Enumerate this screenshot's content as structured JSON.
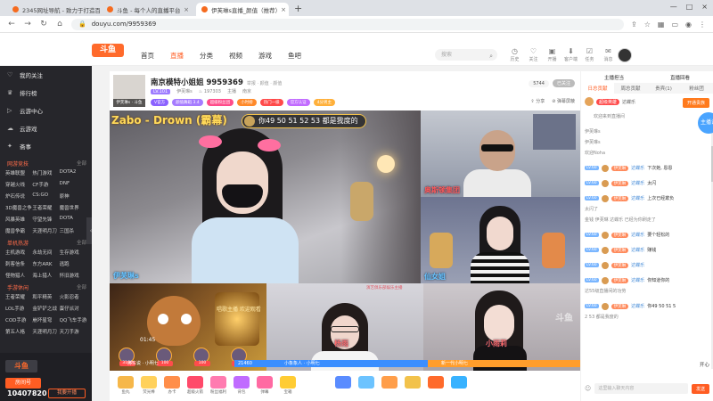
{
  "browser": {
    "tabs": [
      {
        "title": "2345网址导航 - 致力于打造百年..."
      },
      {
        "title": "斗鱼 - 每个人的直播平台"
      },
      {
        "title": "伊芙琳s直播_颜值（推荐）"
      }
    ],
    "url": "douyu.com/9959369"
  },
  "header": {
    "logo": "斗鱼",
    "nav": [
      "首页",
      "直播",
      "分类",
      "视频",
      "游戏",
      "鱼吧"
    ],
    "search_placeholder": "搜索",
    "icons": [
      {
        "name": "history",
        "label": "历史"
      },
      {
        "name": "follow",
        "label": "关注"
      },
      {
        "name": "upload",
        "label": "开播"
      },
      {
        "name": "client",
        "label": "客户端"
      },
      {
        "name": "task",
        "label": "任务"
      },
      {
        "name": "message",
        "label": "消息"
      }
    ]
  },
  "sidebar": {
    "items": [
      {
        "icon": "heart-icon",
        "label": "我的关注"
      },
      {
        "icon": "trophy-icon",
        "label": "排行榜"
      },
      {
        "icon": "play-icon",
        "label": "云游中心"
      },
      {
        "icon": "cloud-icon",
        "label": "云游戏"
      }
    ],
    "sections": [
      {
        "title": "网游竞技",
        "more": "全部",
        "items": [
          "英雄联盟",
          "热门游戏",
          "DOTA2",
          "穿越火线",
          "CF手游",
          "DNF",
          "炉石传说",
          "CS:GO",
          "原神",
          "3D魔兽之争",
          "王者荣耀",
          "魔兽世界",
          "风暴英雄",
          "守望先锋",
          "DOTA",
          "魔兽争霸",
          "天涯明月刀",
          "三国杀"
        ]
      },
      {
        "title": "单机热游",
        "more": "全部",
        "items": [
          "主机游戏",
          "永劫无间",
          "生存游戏",
          "刺客信条",
          "东方ARK",
          "逃跑",
          "怪物猎人",
          "海上猎人",
          "怀旧游戏"
        ]
      },
      {
        "title": "手游休闲",
        "more": "全部",
        "items": [
          "王者荣耀",
          "和平精英",
          "火影忍者",
          "LOL手游",
          "金铲铲之战",
          "蛋仔派对",
          "COD手游",
          "崩坏星穹",
          "QQ飞车手游",
          "第五人格",
          "天涯明月刀",
          "天刀手游"
        ]
      }
    ],
    "bottom": {
      "logo": "斗鱼",
      "room_label": "房间号",
      "room_number": "10407820",
      "live_button": "我要开播"
    },
    "decor": "斋事"
  },
  "room": {
    "anchor_tag": "伊芙琳s · 斗鱼",
    "title": "南京模特小姐姐 9959369",
    "title_sub": "举报 · 颜值 · 颜值",
    "meta": {
      "level": "LV.101",
      "name": "伊芙琳s",
      "hot": "197303",
      "tag1": "主播",
      "tag2": "南京"
    },
    "tags": [
      {
        "text": "V官方",
        "color": "#8b62ff"
      },
      {
        "text": "颜值舞蹈 3.4",
        "color": "#a67cff"
      },
      {
        "text": "超级粉丝团",
        "color": "#ff4c8a"
      },
      {
        "text": "小时榜",
        "color": "#ff8a2b"
      },
      {
        "text": "热门一级",
        "color": "#ff4a4a"
      },
      {
        "text": "官方认证",
        "color": "#c16bff"
      },
      {
        "text": "4分男主",
        "color": "#ffb03a"
      }
    ],
    "fans": "5744",
    "follow": "已关注",
    "share": "分享",
    "report": "弹幕屏蔽"
  },
  "video": {
    "song": "Zabo - Drown (霸幕)",
    "danmu": "你49 50 51 52 53 都是我度的",
    "cells": [
      {
        "name": "伊芙琳s"
      },
      {
        "name": "奥斯顿集团"
      },
      {
        "name": "仙女姐"
      },
      {
        "name": ""
      },
      {
        "name": "杨雨"
      },
      {
        "name": "小雨莉"
      }
    ],
    "cell_room": "演艺俱乐部娱乐主播",
    "bl_text": "唱歌主播 欢迎观看",
    "timer": "01:45",
    "pk": {
      "scores": [
        "3100",
        "100",
        "100",
        "1460"
      ],
      "left_value": "21460",
      "right_value": "",
      "left_fraction": 0.56,
      "names": [
        "房东说 · 小明七",
        "小象象人 · 小明七",
        "新一代小明七"
      ]
    },
    "watermark": "斗鱼"
  },
  "gifts": [
    {
      "label": "鱼丸",
      "color": "#f6b74a"
    },
    {
      "label": "荧光棒",
      "color": "#ffd15c"
    },
    {
      "label": "办卡",
      "color": "#ff8e4a"
    },
    {
      "label": "超级火箭",
      "color": "#ff4a6a"
    },
    {
      "label": "粉丝福利",
      "color": "#ff7bb0"
    },
    {
      "label": "背包",
      "color": "#c06bff"
    },
    {
      "label": "弹幕",
      "color": "#ff6aa2"
    },
    {
      "label": "宝箱",
      "color": "#ffcc33"
    },
    {
      "label": "",
      "color": "#5a8cff"
    },
    {
      "label": "",
      "color": "#6cc3ff"
    },
    {
      "label": "",
      "color": "#ff9e4a"
    },
    {
      "label": "",
      "color": "#f2c24b"
    },
    {
      "label": "",
      "color": "#ff6a2b"
    },
    {
      "label": "",
      "color": "#38b2ff"
    }
  ],
  "rpanel": {
    "top": [
      "主播担当",
      "直播回看"
    ],
    "tabs": [
      "日总贡献",
      "周总贡献",
      "贵宾(1)",
      "粉丝团"
    ],
    "open_button": "开通贵族",
    "rank_tag": "超级英雄",
    "rank_user": "达蝶乐",
    "tagline": "欢迎来到直播间",
    "chat": [
      {
        "type": "sys",
        "text": "伊芙琳s"
      },
      {
        "type": "sys",
        "text": "伊芙琳s"
      },
      {
        "type": "sys",
        "text": "欢迎Noha"
      },
      {
        "type": "msg",
        "lv": "LV.60",
        "fan": "伊芙琳",
        "user": "达蝶乐",
        "text": "下次她, 恩恩"
      },
      {
        "type": "msg",
        "lv": "LV.60",
        "fan": "伊芙琳",
        "user": "达蝶乐",
        "text": "太闪"
      },
      {
        "type": "msg",
        "lv": "LV.60",
        "fan": "伊芙琳",
        "user": "达蝶乐",
        "text": "上次已经欺负"
      },
      {
        "type": "sys",
        "text": "太闪了"
      },
      {
        "type": "sys",
        "text": "金钱 伊芙琳 达蝶乐 已经为你刷走了"
      },
      {
        "type": "msg",
        "lv": "LV.60",
        "fan": "伊芙琳",
        "user": "达蝶乐",
        "text": "要个轻松的"
      },
      {
        "type": "msg",
        "lv": "LV.60",
        "fan": "伊芙琳",
        "user": "达蝶乐",
        "text": "赚钱"
      },
      {
        "type": "msg",
        "lv": "LV.60",
        "fan": "伊芙琳",
        "user": "达蝶乐",
        "text": ""
      },
      {
        "type": "msg",
        "lv": "LV.60",
        "fan": "伊芙琳",
        "user": "达蝶乐",
        "text": "你知道你的"
      },
      {
        "type": "sys",
        "text": "达55级直播间的功劳"
      },
      {
        "type": "msg",
        "lv": "LV.60",
        "fan": "伊芙琳",
        "user": "达蝶乐",
        "text": "你49 50 51 5"
      },
      {
        "type": "sys",
        "text": "2 53 都是我度的"
      }
    ],
    "bottom_label": "开心",
    "input_placeholder": "这里输入聊天内容",
    "send": "发送",
    "float": "主播说"
  }
}
